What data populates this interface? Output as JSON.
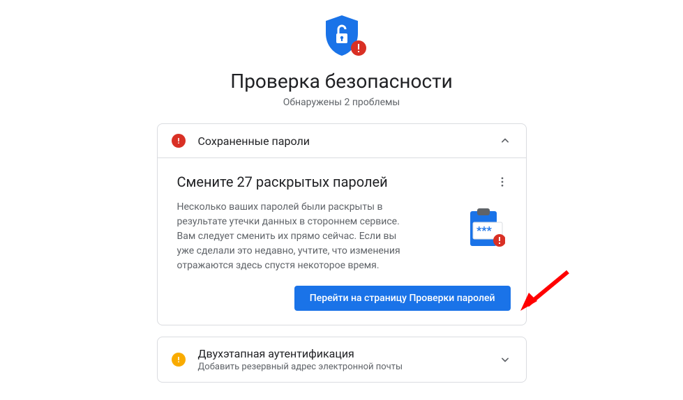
{
  "header": {
    "title": "Проверка безопасности",
    "subtitle": "Обнаружены 2 проблемы"
  },
  "colors": {
    "primary": "#1a73e8",
    "danger": "#d93025",
    "warning": "#f9ab00",
    "text_secondary": "#5f6368"
  },
  "cards": [
    {
      "icon_status": "danger",
      "title": "Сохраненные пароли",
      "expanded": true,
      "detail": {
        "title": "Смените 27 раскрытых паролей",
        "body": "Несколько ваших паролей были раскрыты в результате утечки данных в стороннем сервисе. Вам следует сменить их прямо сейчас. Если вы уже сделали это недавно, учтите, что изменения отражаются здесь спустя некоторое время.",
        "action_label": "Перейти на страницу Проверки паролей"
      }
    },
    {
      "icon_status": "warning",
      "title": "Двухэтапная аутентификация",
      "subtitle": "Добавить резервный адрес электронной почты",
      "expanded": false
    }
  ]
}
